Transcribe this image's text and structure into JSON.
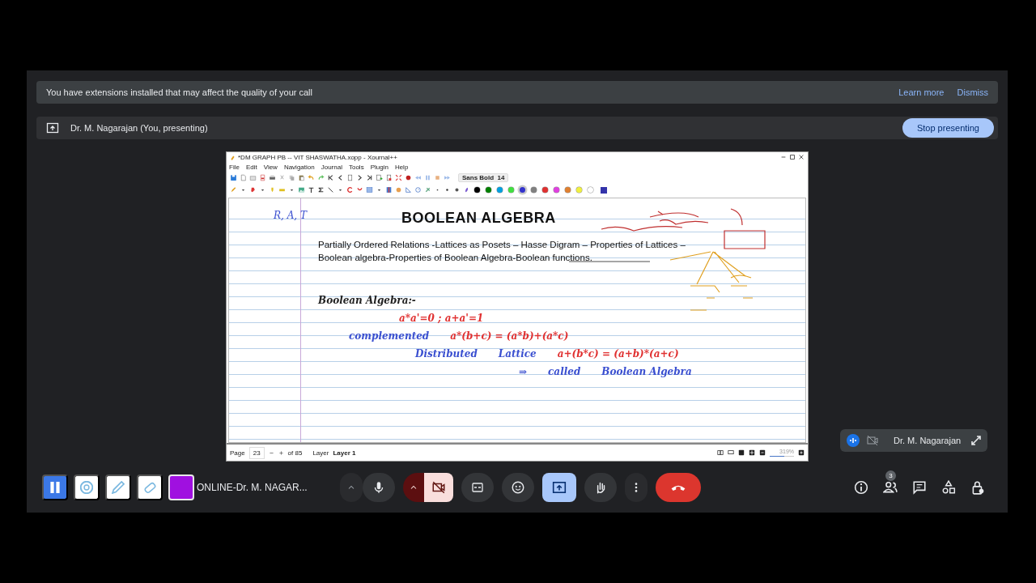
{
  "banner": {
    "message": "You have extensions installed that may affect the quality of your call",
    "actions": [
      "Learn more",
      "Dismiss"
    ]
  },
  "presenting": {
    "label": "Dr. M. Nagarajan (You, presenting)",
    "button": "Stop presenting"
  },
  "shared_window": {
    "title": "*DM GRAPH PB -- VIT SHASWATHA.xopp - Xournal++",
    "menu": [
      "File",
      "Edit",
      "View",
      "Navigation",
      "Journal",
      "Tools",
      "Plugin",
      "Help"
    ],
    "font": {
      "name": "Sans Bold",
      "size": "14"
    },
    "palette": [
      {
        "color": "#000000",
        "selected": false
      },
      {
        "color": "#008000",
        "selected": false
      },
      {
        "color": "#00a0e0",
        "selected": false
      },
      {
        "color": "#40e040",
        "selected": false
      },
      {
        "color": "#3333cc",
        "selected": true
      },
      {
        "color": "#808080",
        "selected": false
      },
      {
        "color": "#e03030",
        "selected": false
      },
      {
        "color": "#e040e0",
        "selected": false
      },
      {
        "color": "#e08030",
        "selected": false
      },
      {
        "color": "#f0f040",
        "selected": false
      },
      {
        "color": "#ffffff",
        "selected": false
      }
    ],
    "page": {
      "heading": "BOOLEAN ALGEBRA",
      "paragraph": [
        "Partially Ordered Relations -Lattices as Posets – Hasse Digram – Properties of Lattices –",
        "Boolean algebra-Properties of Boolean Algebra-Boolean functions."
      ],
      "margin_note": {
        "text": "R, A, T",
        "color": "#3a4fd0"
      },
      "ink_lines": [
        [
          {
            "text": "Boolean Algebra:-",
            "color": "#222222"
          }
        ],
        [
          {
            "text": "a*a'=0 ; a+a'=1",
            "color": "#e03030"
          }
        ],
        [
          {
            "text": "complemented",
            "color": "#3a4fd0"
          },
          {
            "text": "a*(b+c) = (a*b)+(a*c)",
            "color": "#e03030"
          }
        ],
        [
          {
            "text": "Distributed",
            "color": "#3a4fd0"
          },
          {
            "text": "Lattice",
            "color": "#3a4fd0"
          },
          {
            "text": "a+(b*c) = (a+b)*(a+c)",
            "color": "#e03030"
          }
        ],
        [
          {
            "text": "⇒",
            "color": "#3a4fd0"
          },
          {
            "text": "called",
            "color": "#3a4fd0"
          },
          {
            "text": "Boolean Algebra",
            "color": "#3a4fd0"
          }
        ]
      ]
    },
    "status": {
      "page_label": "Page",
      "page": "23",
      "total": "of 85",
      "layer_label": "Layer",
      "layer": "Layer 1",
      "zoom": "319%",
      "zoom_slider": {
        "level": 0.6
      }
    }
  },
  "tile": {
    "name": "Dr. M. Nagarajan"
  },
  "annotation_tools": [
    {
      "kind": "pause"
    },
    {
      "kind": "laser"
    },
    {
      "kind": "pen"
    },
    {
      "kind": "eraser"
    },
    {
      "kind": "color",
      "color": "#a010e0"
    }
  ],
  "meeting_title": "ONLINE-Dr. M. NAGAR...",
  "people_count": "3"
}
